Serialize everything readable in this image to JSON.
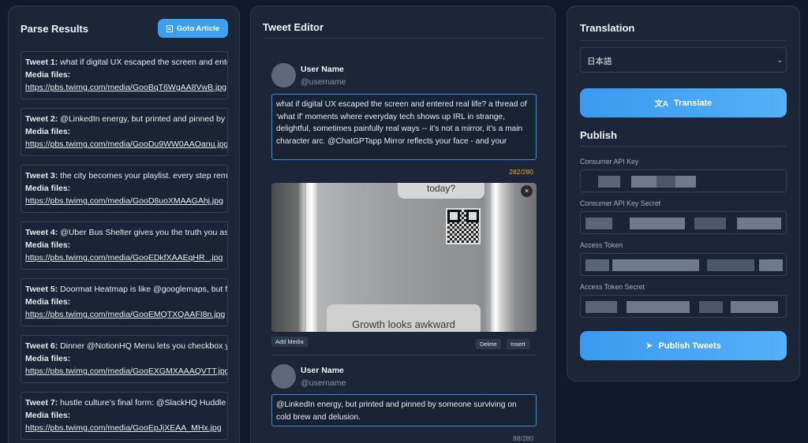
{
  "parse_results": {
    "title": "Parse Results",
    "goto_label": "Goto Article",
    "media_label": "Media files:",
    "tweets": [
      {
        "label": "Tweet 1:",
        "text": "what if digital UX escaped the screen and entered real life?",
        "url": "https://pbs.twimg.com/media/GooBqT6WgAA8VwB.jpg"
      },
      {
        "label": "Tweet 2:",
        "text": "@LinkedIn energy, but printed and pinned by someone surviving on cold brew and delusion.",
        "url": "https://pbs.twimg.com/media/GooDu9WW0AAOanu.jpg"
      },
      {
        "label": "Tweet 3:",
        "text": "the city becomes your playlist. every step rem",
        "url": "https://pbs.twimg.com/media/GooD8uoXMAAGAhj.jpg"
      },
      {
        "label": "Tweet 4:",
        "text": "@Uber Bus Shelter gives you the truth you ask",
        "url": "https://pbs.twimg.com/media/GooEDkfXAAEqHR_.jpg"
      },
      {
        "label": "Tweet 5:",
        "text": "Doormat Heatmap is like @googlemaps, but for",
        "url": "https://pbs.twimg.com/media/GooEMQTXQAAFI8n.jpg"
      },
      {
        "label": "Tweet 6:",
        "text": "Dinner @NotionHQ Menu lets you checkbox your",
        "url": "https://pbs.twimg.com/media/GooEXGMXAAAQVTT.jpg"
      },
      {
        "label": "Tweet 7:",
        "text": "hustle culture’s final form: @SlackHQ Huddle",
        "url": "https://pbs.twimg.com/media/GooEpJjXEAA_MHx.jpg"
      }
    ]
  },
  "editor": {
    "title": "Tweet Editor",
    "add_media": "Add Media",
    "delete": "Delete",
    "insert": "Insert",
    "tweets": [
      {
        "user_name": "User Name",
        "handle": "@username",
        "text": "what if digital UX escaped the screen and entered real life? a thread of ‘what if’ moments where everyday tech shows up IRL in strange, delightful, sometimes painfully real ways -- it’s not a mirror, it’s a main character arc. @ChatGPTapp Mirror reflects your face - and your",
        "counter": "282/280",
        "counter_color": "#f5a623"
      },
      {
        "user_name": "User Name",
        "handle": "@username",
        "text": "@LinkedIn energy, but printed and pinned by someone surviving on cold brew and delusion.",
        "counter": "88/280",
        "counter_color": "#8b96a6"
      }
    ],
    "media": {
      "bubble_top": "today?",
      "bubble_bottom": "Growth looks awkward",
      "close": "×"
    }
  },
  "translation": {
    "title": "Translation",
    "language": "日本語",
    "translate_label": "Translate",
    "publish_title": "Publish",
    "fields": [
      {
        "label": "Consumer API Key"
      },
      {
        "label": "Consumer API Key Secret"
      },
      {
        "label": "Access Token"
      },
      {
        "label": "Access Token Secret"
      }
    ],
    "publish_label": "Publish Tweets"
  },
  "colors": {
    "accent": "#3d9fef",
    "background": "#101a2b",
    "panel": "#1c2638"
  }
}
